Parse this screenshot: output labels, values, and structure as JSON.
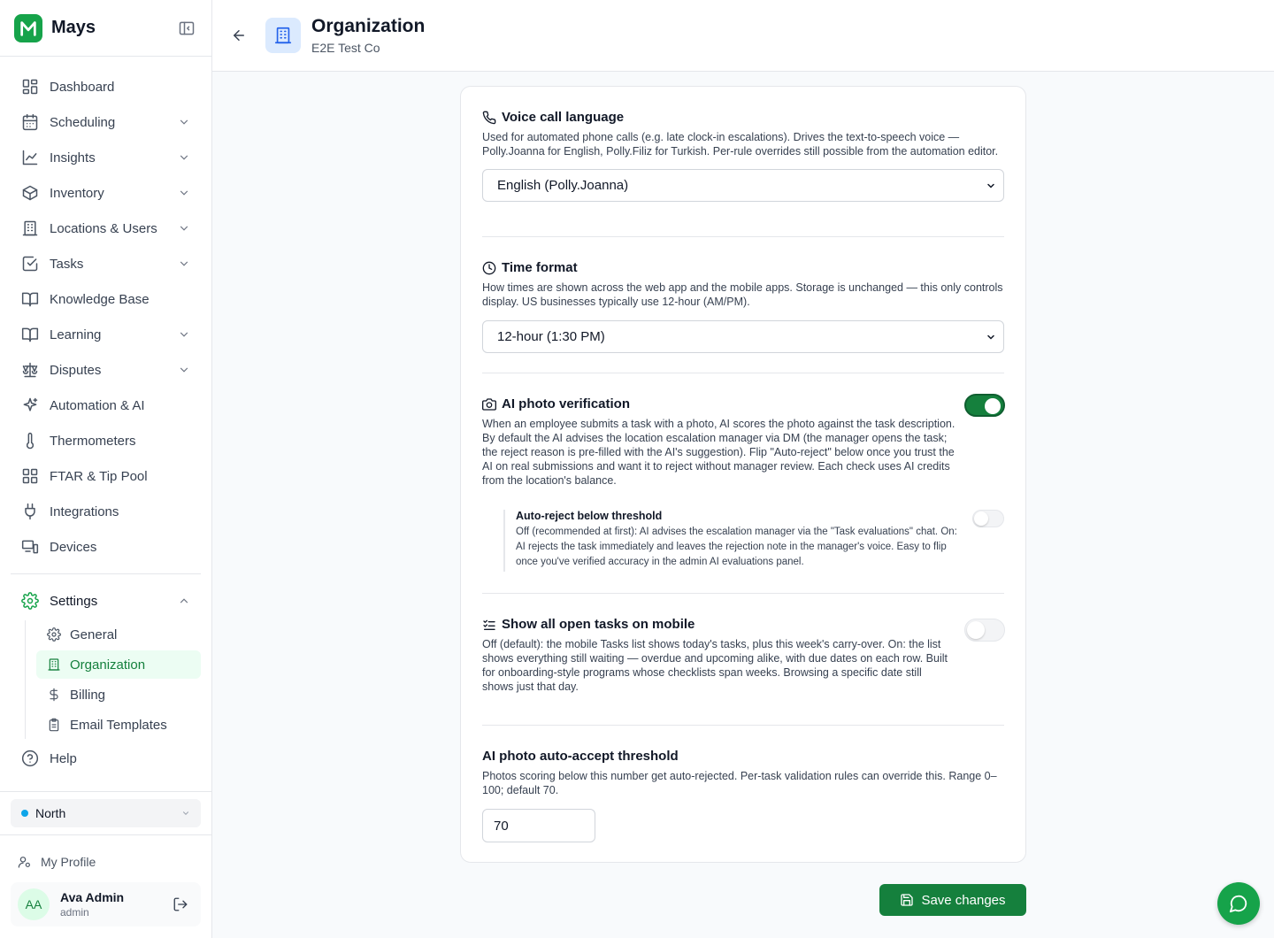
{
  "brand": {
    "name": "Mays"
  },
  "nav": {
    "items": [
      {
        "label": "Dashboard",
        "icon": "dashboard-icon",
        "has_chevron": false
      },
      {
        "label": "Scheduling",
        "icon": "calendar-icon",
        "has_chevron": true
      },
      {
        "label": "Insights",
        "icon": "chart-line-icon",
        "has_chevron": true
      },
      {
        "label": "Inventory",
        "icon": "box-icon",
        "has_chevron": true
      },
      {
        "label": "Locations & Users",
        "icon": "building-icon",
        "has_chevron": true
      },
      {
        "label": "Tasks",
        "icon": "checkbox-icon",
        "has_chevron": true
      },
      {
        "label": "Knowledge Base",
        "icon": "book-icon",
        "has_chevron": false
      },
      {
        "label": "Learning",
        "icon": "book-open-icon",
        "has_chevron": true
      },
      {
        "label": "Disputes",
        "icon": "scale-icon",
        "has_chevron": true
      },
      {
        "label": "Automation & AI",
        "icon": "sparkles-icon",
        "has_chevron": false
      },
      {
        "label": "Thermometers",
        "icon": "thermometer-icon",
        "has_chevron": false
      },
      {
        "label": "FTAR & Tip Pool",
        "icon": "grid-icon",
        "has_chevron": false
      },
      {
        "label": "Integrations",
        "icon": "plug-icon",
        "has_chevron": false
      },
      {
        "label": "Devices",
        "icon": "devices-icon",
        "has_chevron": false
      }
    ],
    "settings": {
      "label": "Settings",
      "sub_items": [
        {
          "label": "General",
          "icon": "gear-icon",
          "active": false
        },
        {
          "label": "Organization",
          "icon": "building-icon",
          "active": true
        },
        {
          "label": "Billing",
          "icon": "dollar-icon",
          "active": false
        },
        {
          "label": "Email Templates",
          "icon": "clipboard-icon",
          "active": false
        }
      ]
    },
    "help": "Help"
  },
  "location": {
    "selected": "North",
    "dot_color": "#0ea5e9"
  },
  "profile": {
    "link": "My Profile",
    "initials": "AA",
    "name": "Ava Admin",
    "role": "admin"
  },
  "header": {
    "title": "Organization",
    "subtitle": "E2E Test Co"
  },
  "sections": {
    "voice": {
      "title": "Voice call language",
      "description": "Used for automated phone calls (e.g. late clock-in escalations). Drives the text-to-speech voice — Polly.Joanna for English, Polly.Filiz for Turkish. Per-rule overrides still possible from the automation editor.",
      "value": "English (Polly.Joanna)"
    },
    "time": {
      "title": "Time format",
      "description": "How times are shown across the web app and the mobile apps. Storage is unchanged — this only controls display. US businesses typically use 12-hour (AM/PM).",
      "value": "12-hour (1:30 PM)"
    },
    "photo": {
      "title": "AI photo verification",
      "description": "When an employee submits a task with a photo, AI scores the photo against the task description. By default the AI advises the location escalation manager via DM (the manager opens the task; the reject reason is pre-filled with the AI's suggestion). Flip \"Auto-reject\" below once you trust the AI on real submissions and want it to reject without manager review. Each check uses AI credits from the location's balance.",
      "enabled": true,
      "auto_reject": {
        "title": "Auto-reject below threshold",
        "description": "Off (recommended at first): AI advises the escalation manager via the \"Task evaluations\" chat. On: AI rejects the task immediately and leaves the rejection note in the manager's voice. Easy to flip once you've verified accuracy in the admin AI evaluations panel.",
        "enabled": false
      }
    },
    "mobile": {
      "title": "Show all open tasks on mobile",
      "description": "Off (default): the mobile Tasks list shows today's tasks, plus this week's carry-over. On: the list shows everything still waiting — overdue and upcoming alike, with due dates on each row. Built for onboarding-style programs whose checklists span weeks. Browsing a specific date still shows just that day.",
      "enabled": false
    },
    "threshold": {
      "title": "AI photo auto-accept threshold",
      "description": "Photos scoring below this number get auto-rejected. Per-task validation rules can override this. Range 0–100; default 70.",
      "value": "70"
    }
  },
  "actions": {
    "save": "Save changes"
  },
  "colors": {
    "accent": "#15803d",
    "brand": "#16a34a"
  }
}
